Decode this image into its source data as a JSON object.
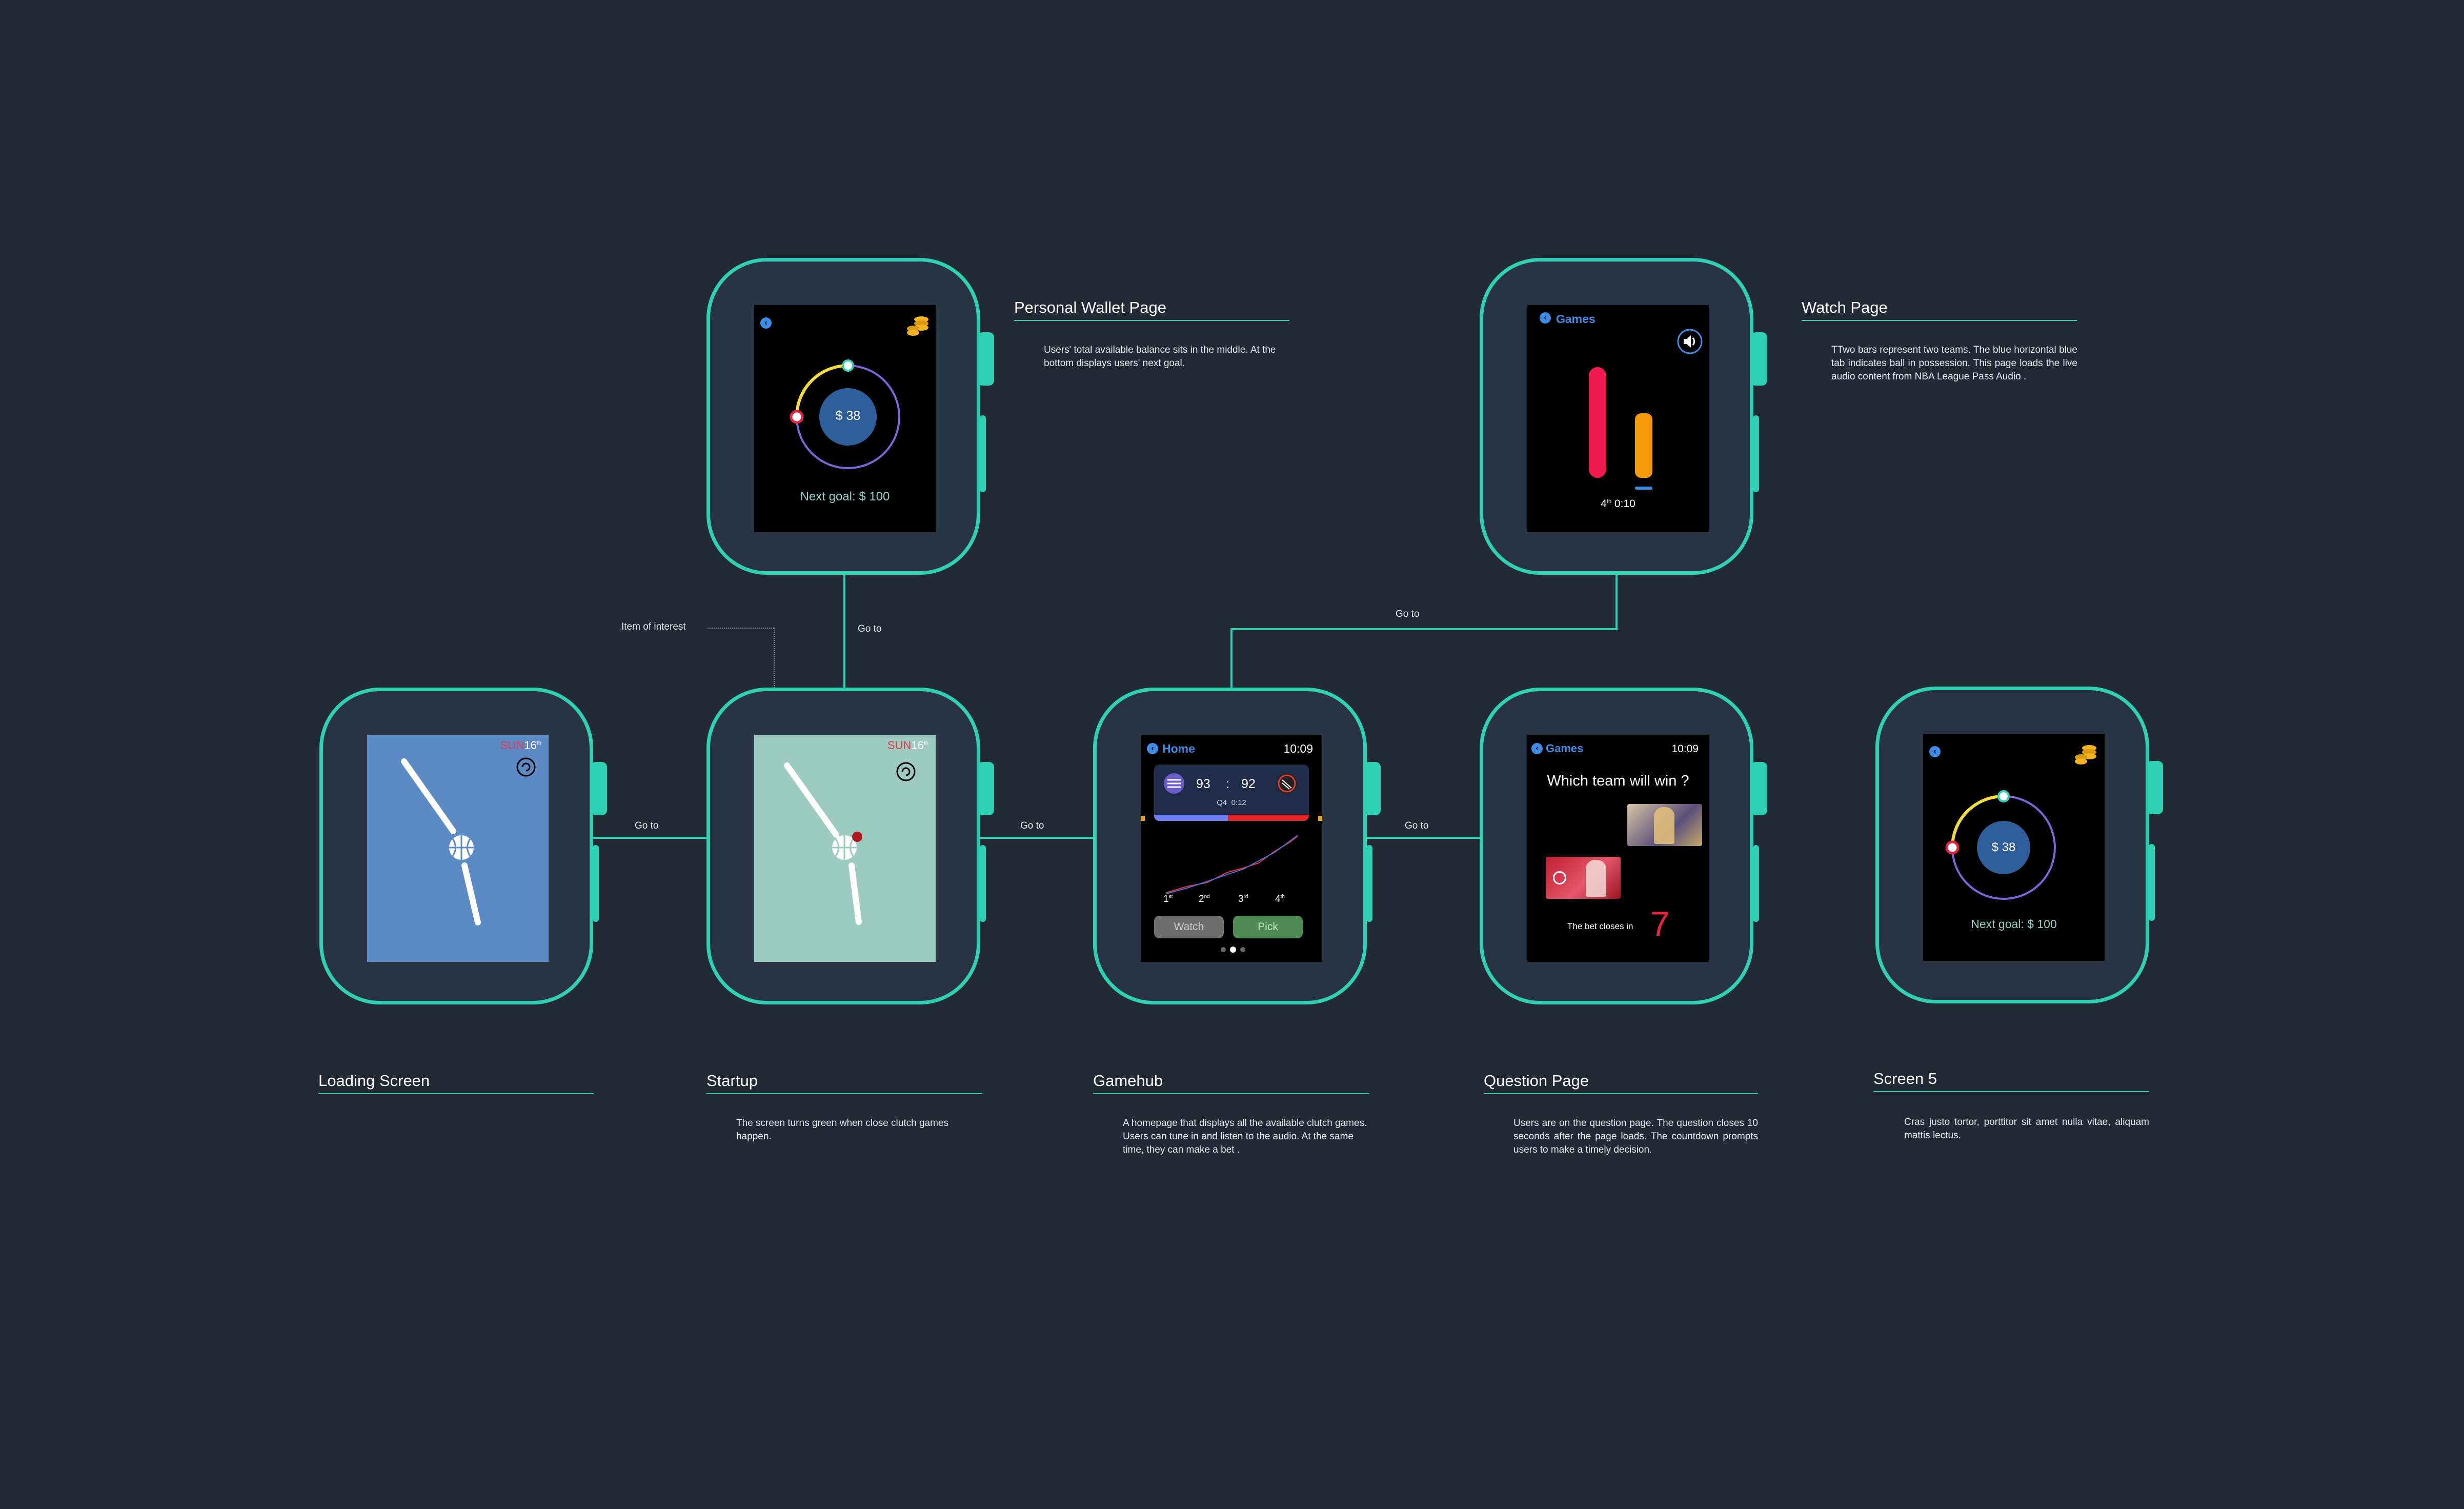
{
  "colors": {
    "background": "#222a36",
    "accent": "#2fd1b5",
    "loading_screen": "#5b8ac4",
    "startup_screen": "#9ecbbf"
  },
  "connector_label": "Go to",
  "annotation": "Item of interest",
  "screens": {
    "loading": {
      "title": "Loading Screen",
      "day": "SUN",
      "date": "16",
      "date_sup": "th"
    },
    "startup": {
      "title": "Startup",
      "description": "The screen turns green when close clutch games happen.",
      "day": "SUN",
      "date": "16",
      "date_sup": "th"
    },
    "gamehub": {
      "title": "Gamehub",
      "description": "A homepage that displays all the available clutch games. Users can tune in and listen to the audio. At the same time, they can make a bet .",
      "nav": "Home",
      "time": "10:09",
      "score_home": "93",
      "score_sep": ":",
      "score_away": "92",
      "period_clock": "Q4  0:12",
      "quarters": [
        {
          "num": "1",
          "sup": "st"
        },
        {
          "num": "2",
          "sup": "nd"
        },
        {
          "num": "3",
          "sup": "rd"
        },
        {
          "num": "4",
          "sup": "th"
        }
      ],
      "watch_button": "Watch",
      "pick_button": "Pick"
    },
    "question": {
      "title": "Question Page",
      "description": "Users are on the question page. The question closes  10 seconds after the  page loads. The countdown prompts users to make a timely decision.",
      "nav": "Games",
      "time": "10:09",
      "question": "Which team will win ?",
      "closes_label": "The bet closes in",
      "countdown": "7"
    },
    "screen5": {
      "title": "Screen 5",
      "description": "Cras justo tortor, porttitor sit amet nulla vitae, aliquam mattis lectus.",
      "balance": "$ 38",
      "next_goal": "Next goal: $ 100",
      "progress": 0.25
    },
    "wallet": {
      "title": "Personal Wallet Page",
      "description": "Users' total available balance sits in the middle. At the bottom displays users' next goal.",
      "balance": "$ 38",
      "next_goal": "Next goal: $ 100",
      "progress": 0.25
    },
    "watchpage": {
      "title": "Watch Page",
      "description": "TTwo  bars  represent  two  teams.  The  blue horizontal blue tab indicates ball in possession. This page loads the live audio content from NBA League Pass Audio .",
      "nav": "Games",
      "quarter": "4",
      "quarter_sup": "th",
      "clock": "0:10",
      "team_levels": [
        0.72,
        0.42
      ]
    }
  }
}
